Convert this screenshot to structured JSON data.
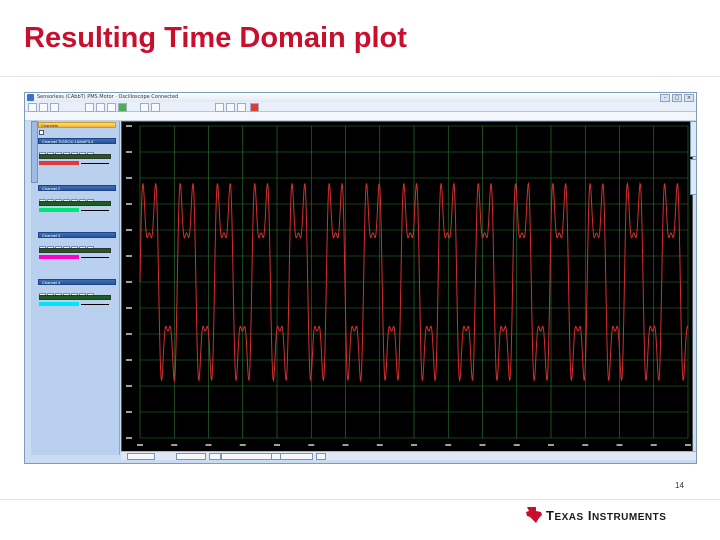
{
  "slide": {
    "title": "Resulting Time Domain plot",
    "page_number": "14",
    "logo_text": "Texas Instruments"
  },
  "app": {
    "window_title": "Sensorless (CAbbT) PMS Motor · Oscilloscope Connected",
    "panel_header": "Channels",
    "channel_names": [
      "Channel TIGROU 1&M#P3.4",
      "Channel 2",
      "Channel 3",
      "Channel 4"
    ],
    "channel_colors": [
      "#e53935",
      "#00e676",
      "#ff00cc",
      "#00e5ff"
    ],
    "trace_color": "#d32f2f",
    "grid_color": "#2e7d32"
  },
  "chart_data": {
    "type": "line",
    "series": [
      {
        "color": "#d32f2f",
        "x_period": 34,
        "x_range": [
          0,
          500
        ],
        "y_range": [
          0,
          250
        ]
      }
    ],
    "grid": true
  }
}
